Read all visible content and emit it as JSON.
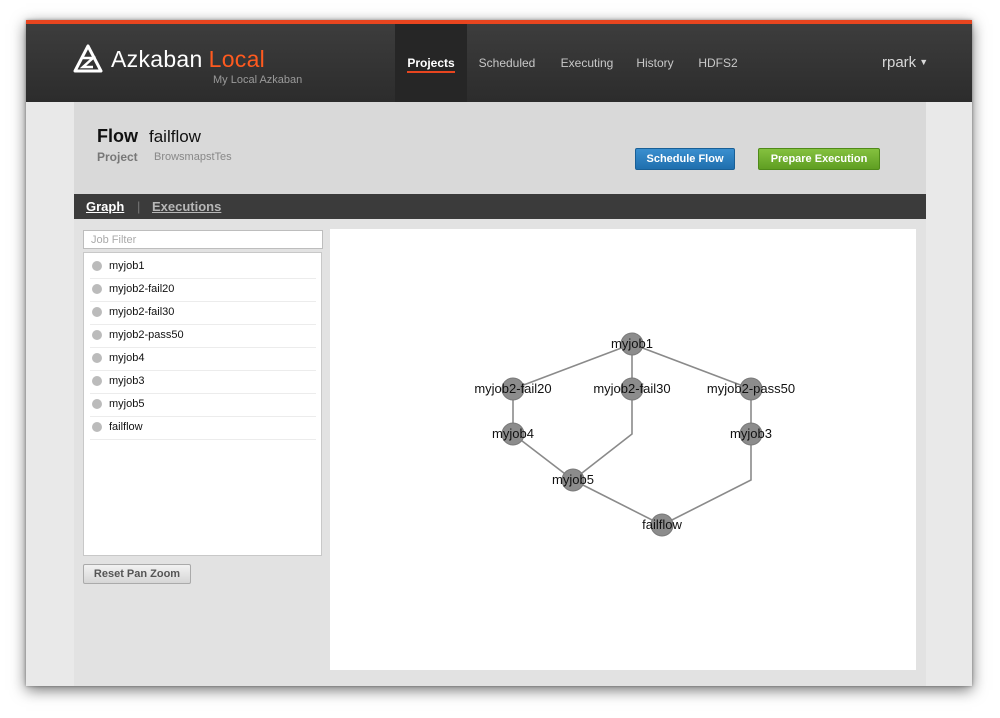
{
  "app": {
    "brand": "Azkaban",
    "brand_suffix": "Local",
    "subtitle": "My Local Azkaban"
  },
  "nav": {
    "items": [
      "Projects",
      "Scheduled",
      "Executing",
      "History",
      "HDFS2"
    ],
    "active": "Projects",
    "user": "rpark"
  },
  "flow": {
    "label": "Flow",
    "name": "failflow",
    "project_label": "Project",
    "project_name": "BrowsmapstTes"
  },
  "buttons": {
    "schedule": "Schedule Flow",
    "prepare": "Prepare Execution",
    "reset": "Reset Pan Zoom"
  },
  "tabs": {
    "graph": "Graph",
    "separator": "|",
    "executions": "Executions"
  },
  "job_filter": {
    "placeholder": "Job Filter",
    "value": ""
  },
  "jobs": [
    "myjob1",
    "myjob2-fail20",
    "myjob2-fail30",
    "myjob2-pass50",
    "myjob4",
    "myjob3",
    "myjob5",
    "failflow"
  ],
  "graph": {
    "nodes": [
      {
        "id": "myjob1",
        "label": "myjob1"
      },
      {
        "id": "myjob2-fail20",
        "label": "myjob2-fail20"
      },
      {
        "id": "myjob2-fail30",
        "label": "myjob2-fail30"
      },
      {
        "id": "myjob2-pass50",
        "label": "myjob2-pass50"
      },
      {
        "id": "myjob4",
        "label": "myjob4"
      },
      {
        "id": "myjob3",
        "label": "myjob3"
      },
      {
        "id": "myjob5",
        "label": "myjob5"
      },
      {
        "id": "failflow",
        "label": "failflow"
      }
    ],
    "edges": [
      [
        "myjob1",
        "myjob2-fail20"
      ],
      [
        "myjob1",
        "myjob2-fail30"
      ],
      [
        "myjob1",
        "myjob2-pass50"
      ],
      [
        "myjob2-fail20",
        "myjob4"
      ],
      [
        "myjob2-pass50",
        "myjob3"
      ],
      [
        "myjob4",
        "myjob5"
      ],
      [
        "myjob2-fail30",
        "myjob5"
      ],
      [
        "myjob5",
        "failflow"
      ],
      [
        "myjob3",
        "failflow"
      ]
    ]
  }
}
